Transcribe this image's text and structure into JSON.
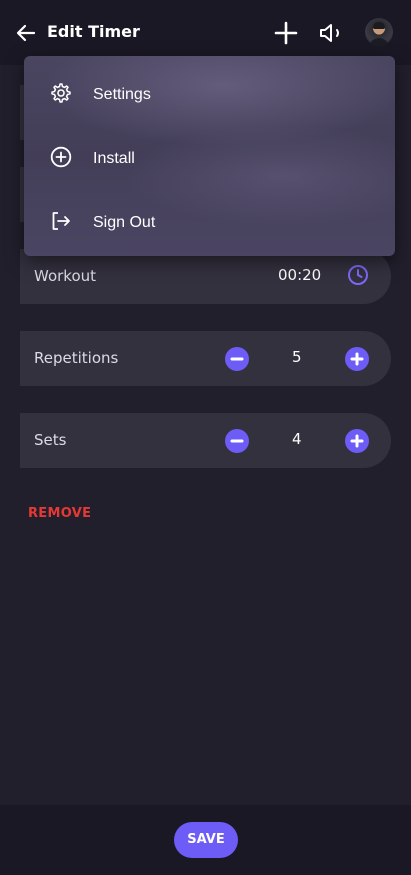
{
  "header": {
    "title": "Edit Timer"
  },
  "menu": {
    "items": [
      {
        "label": "Settings",
        "icon": "gear-icon"
      },
      {
        "label": "Install",
        "icon": "plus-circle-icon"
      },
      {
        "label": "Sign Out",
        "icon": "sign-out-icon"
      }
    ]
  },
  "rows": {
    "workout": {
      "label": "Workout",
      "value": "00:20"
    },
    "repetitions": {
      "label": "Repetitions",
      "value": "5"
    },
    "sets": {
      "label": "Sets",
      "value": "4"
    }
  },
  "remove_label": "REMOVE",
  "save_label": "SAVE",
  "colors": {
    "accent": "#6e5cf6",
    "danger": "#e53935",
    "background": "#211f2c",
    "row": "#34313f"
  }
}
